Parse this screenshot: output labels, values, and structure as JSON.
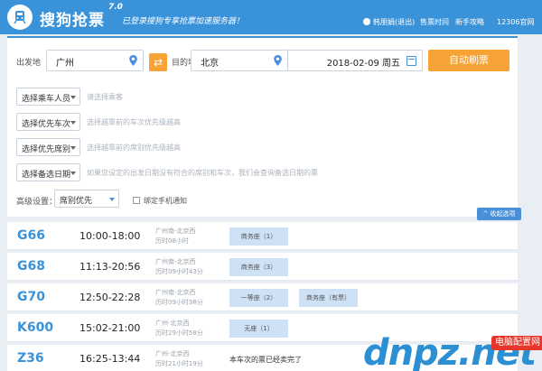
{
  "header": {
    "app_name": "搜狗抢票",
    "version": "7.0",
    "slogan": "已登录搜狗专享抢票加速服务器！",
    "user": "韩朋娟(退出)",
    "nav": [
      "售票时间",
      "新手攻略",
      "12306官网"
    ]
  },
  "search": {
    "from_label": "出发地",
    "from_value": "广州",
    "to_label": "目的地",
    "to_value": "北京",
    "date_value": "2018-02-09  周五",
    "auto_button": "自动刷票"
  },
  "filters": [
    {
      "label": "选择乘车人员",
      "hint": "请选择乘客"
    },
    {
      "label": "选择优先车次",
      "hint": "选择越靠前的车次优先级越高"
    },
    {
      "label": "选择优先席别",
      "hint": "选择越靠前的席别优先级越高"
    },
    {
      "label": "选择备选日期",
      "hint": "如果您设定的出发日期没有符合的席别和车次，我们会查询备选日期的票"
    }
  ],
  "advanced": {
    "label": "高级设置：",
    "seat_pref": "席别优先",
    "notify_label": "绑定手机通知",
    "collapse_button": "收起选项"
  },
  "trains": [
    {
      "number": "G66",
      "time": "10:00-18:00",
      "route": "广州南-北京西",
      "duration": "历时08小时",
      "seats": [
        "商务座（1）"
      ],
      "status": ""
    },
    {
      "number": "G68",
      "time": "11:13-20:56",
      "route": "广州南-北京西",
      "duration": "历时09小时43分",
      "seats": [
        "商务座（3）"
      ],
      "status": ""
    },
    {
      "number": "G70",
      "time": "12:50-22:28",
      "route": "广州南-北京西",
      "duration": "历时09小时38分",
      "seats": [
        "一等座（2）",
        "商务座（有票）"
      ],
      "status": ""
    },
    {
      "number": "K600",
      "time": "15:02-21:00",
      "route": "广州-北京西",
      "duration": "历时29小时58分",
      "seats": [
        "无座（1）"
      ],
      "status": ""
    },
    {
      "number": "Z36",
      "time": "16:25-13:44",
      "route": "广州-北京西",
      "duration": "历时21小时19分",
      "seats": [],
      "status": "本车次的票已经卖完了"
    }
  ],
  "watermark": {
    "text": "dnpz.net",
    "badge": "电脑配置网"
  },
  "colors": {
    "primary": "#3a92d9",
    "accent": "#f6a234",
    "seat_tag": "#cfe2f5"
  }
}
